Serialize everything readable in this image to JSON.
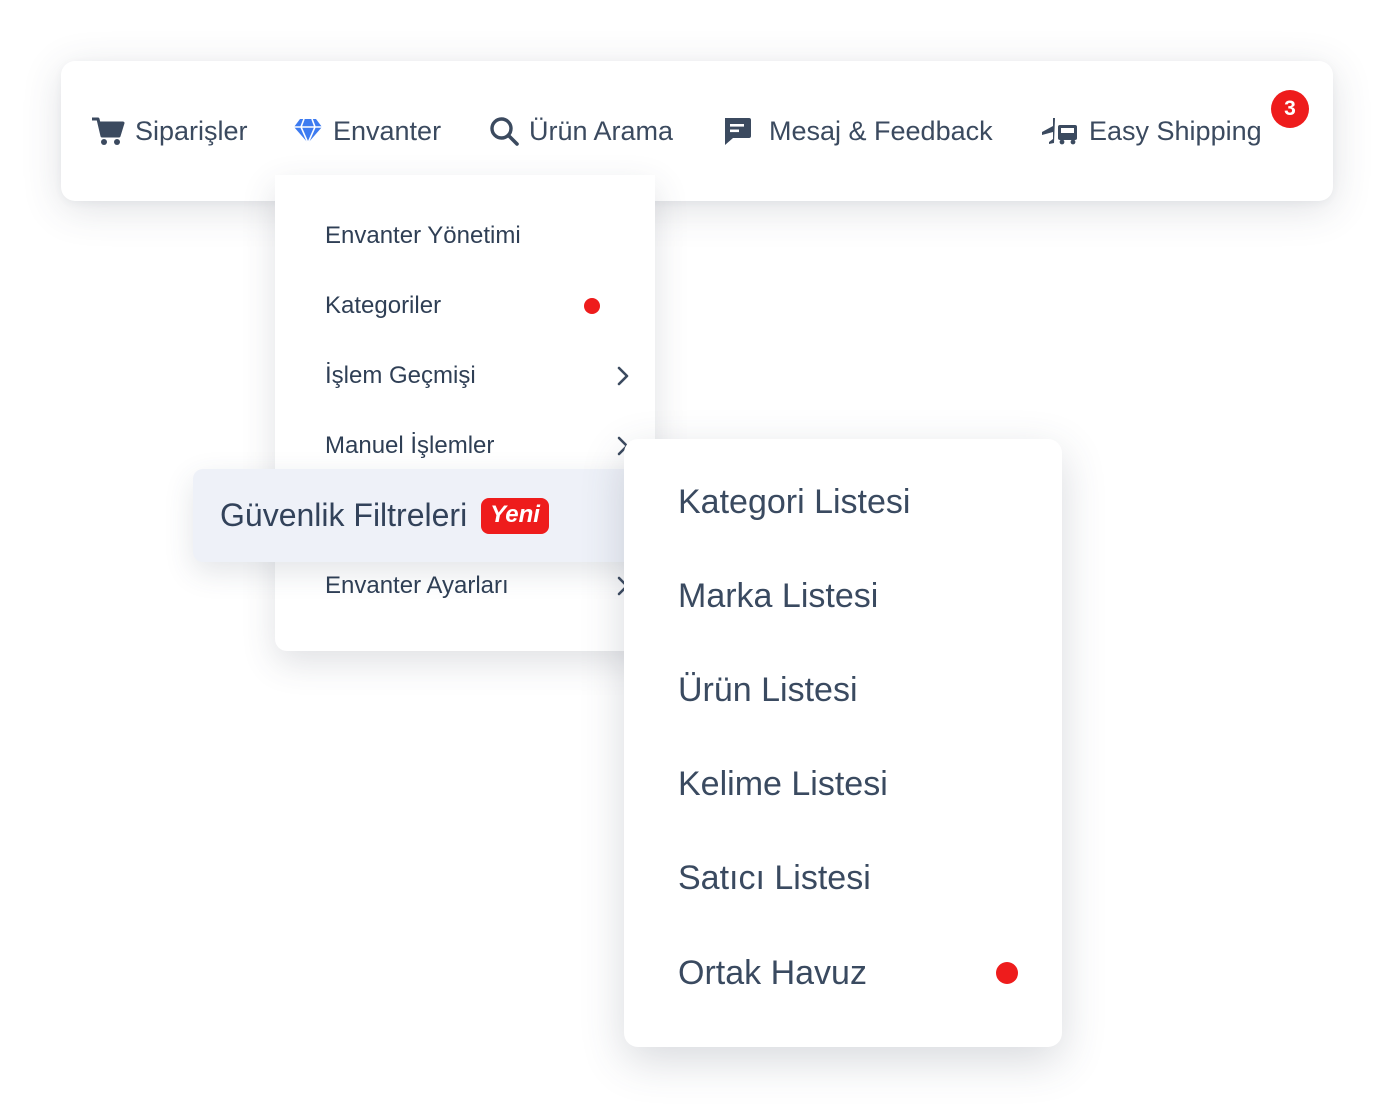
{
  "nav": {
    "items": [
      {
        "label": "Siparişler",
        "icon": "cart-icon"
      },
      {
        "label": "Envanter",
        "icon": "diamond-icon"
      },
      {
        "label": "Ürün Arama",
        "icon": "search-icon"
      },
      {
        "label": "Mesaj & Feedback",
        "icon": "message-icon"
      },
      {
        "label": "Easy Shipping",
        "icon": "shipping-icon"
      }
    ],
    "shipping_badge": "3"
  },
  "dropdown": {
    "items": [
      {
        "label": "Envanter Yönetimi"
      },
      {
        "label": "Kategoriler",
        "indicator": "red-dot"
      },
      {
        "label": "İşlem Geçmişi",
        "indicator": "chevron-right-icon"
      },
      {
        "label": "Manuel İşlemler",
        "indicator": "chevron-right-icon"
      },
      {
        "label": "Envanter Ayarları",
        "indicator": "chevron-right-icon"
      }
    ],
    "highlighted": {
      "label": "Güvenlik Filtreleri",
      "tag": "Yeni"
    }
  },
  "submenu": {
    "items": [
      {
        "label": "Kategori Listesi"
      },
      {
        "label": "Marka Listesi"
      },
      {
        "label": "Ürün Listesi"
      },
      {
        "label": "Kelime Listesi"
      },
      {
        "label": "Satıcı Listesi"
      },
      {
        "label": "Ortak Havuz",
        "indicator": "red-dot"
      }
    ]
  },
  "colors": {
    "text": "#3b4a5f",
    "accent_blue": "#3d7bf0",
    "badge_red": "#ee1c1c",
    "highlight_bg": "#eef1f8"
  }
}
